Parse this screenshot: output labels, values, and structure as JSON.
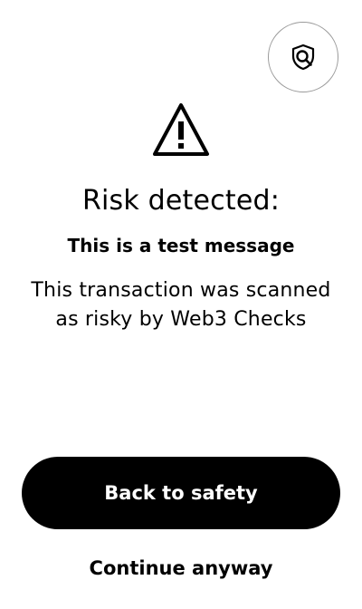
{
  "header": {
    "scan_icon": "shield-search-icon"
  },
  "alert": {
    "icon": "warning-triangle-icon",
    "title": "Risk detected:",
    "subtitle": "This is a test message",
    "description": "This transaction was scanned as risky by Web3 Checks"
  },
  "actions": {
    "primary_label": "Back to safety",
    "secondary_label": "Continue anyway"
  },
  "colors": {
    "background": "#ffffff",
    "text": "#000000",
    "primary_button_bg": "#000000",
    "primary_button_text": "#ffffff",
    "badge_border": "#9a9a9a"
  }
}
